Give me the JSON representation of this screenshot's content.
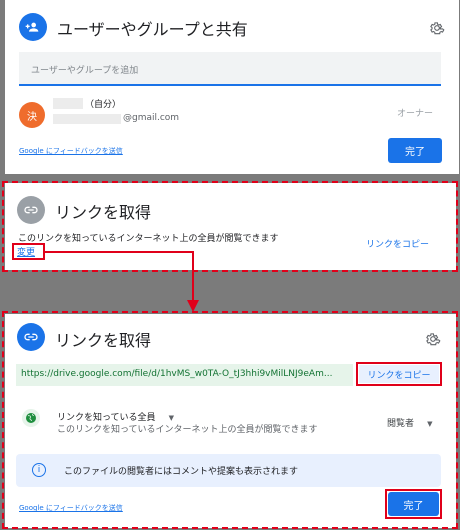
{
  "share_panel": {
    "title": "ユーザーやグループと共有",
    "input_placeholder": "ユーザーやグループを追加",
    "user": {
      "avatar_letter": "決",
      "suffix": "（自分）",
      "email_suffix": "@gmail.com",
      "role": "オーナー"
    },
    "feedback": "Google にフィードバックを送信",
    "done": "完了"
  },
  "get_link_collapsed": {
    "title": "リンクを取得",
    "description": "このリンクを知っているインターネット上の全員が閲覧できます",
    "change": "変更",
    "copy": "リンクをコピー"
  },
  "get_link_expanded": {
    "title": "リンクを取得",
    "url": "https://drive.google.com/file/d/1hvMS_w0TA-O_tJ3hhi9vMilLNJ9eAm...",
    "copy": "リンクをコピー",
    "access_label": "リンクを知っている全員",
    "access_desc": "このリンクを知っているインターネット上の全員が閲覧できます",
    "role": "閲覧者",
    "info": "このファイルの閲覧者にはコメントや提案も表示されます",
    "feedback": "Google にフィードバックを送信",
    "done": "完了"
  },
  "colors": {
    "accent": "#1a73e8",
    "highlight": "#e0001a",
    "avatar": "#ef6c2c",
    "globe": "#1e8e3e"
  }
}
